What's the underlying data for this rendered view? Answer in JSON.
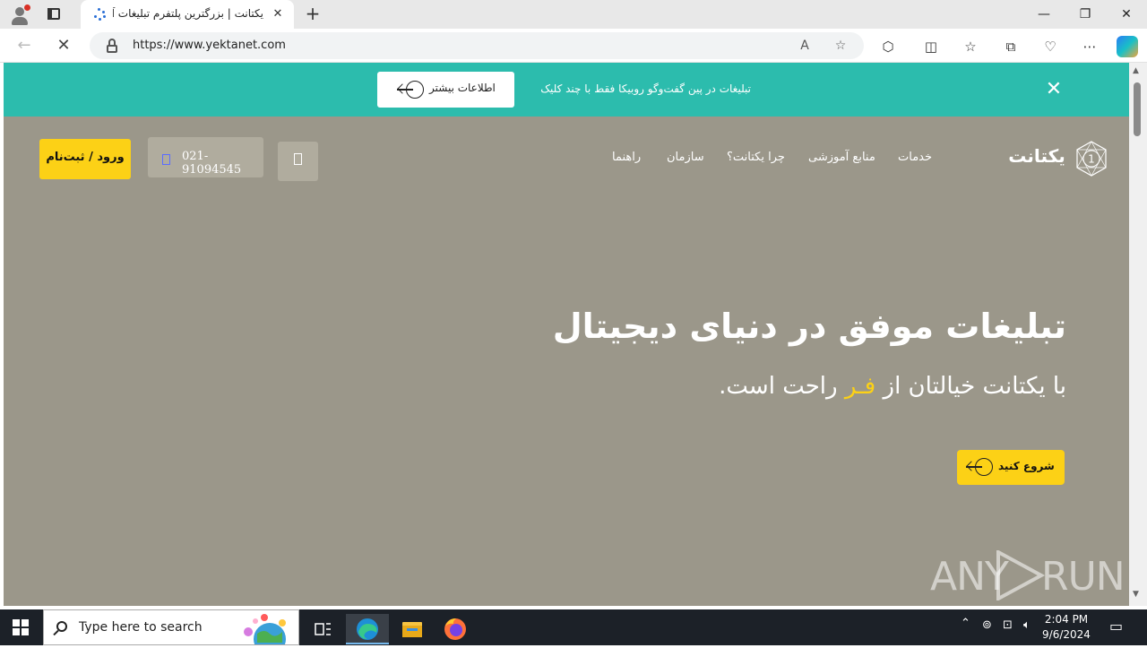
{
  "browser": {
    "tab_title": "یکتانت | بزرگترین پلتفرم تبلیغات آنلاین",
    "url": "https://www.yektanet.com",
    "window_controls": {
      "minimize": "—",
      "maximize": "❐",
      "close": "✕"
    },
    "tab_close": "✕",
    "new_tab": "+"
  },
  "promo": {
    "text": "تبلیغات در پین گفت‌وگو روبیکا فقط با چند کلیک",
    "button_label": "اطلاعات بیشتر",
    "close": "✕"
  },
  "header": {
    "logo_text": "یکتانت",
    "logo_badge": "1",
    "nav": [
      "خدمات",
      "منابع آموزشی",
      "چرا یکتانت؟",
      "سازمان",
      "راهنما"
    ],
    "phone": "021-91094545",
    "login_label": "ورود / ثبت‌نام"
  },
  "hero": {
    "title": "تبلیغات موفق در دنیای دیجیتال",
    "subtitle_before": "با یکتانت خیالتان از ",
    "subtitle_accent": "فـر",
    "subtitle_after": " راحت است.",
    "cta_label": "شروع کنید"
  },
  "watermark": {
    "left": "ANY",
    "right": "RUN"
  },
  "taskbar": {
    "search_placeholder": "Type here to search",
    "time": "2:04 PM",
    "date": "9/6/2024"
  },
  "colors": {
    "promo_bg": "#2cbcad",
    "page_bg": "#9b978a",
    "accent_yellow": "#fcd116",
    "taskbar_bg": "#1c2128"
  }
}
